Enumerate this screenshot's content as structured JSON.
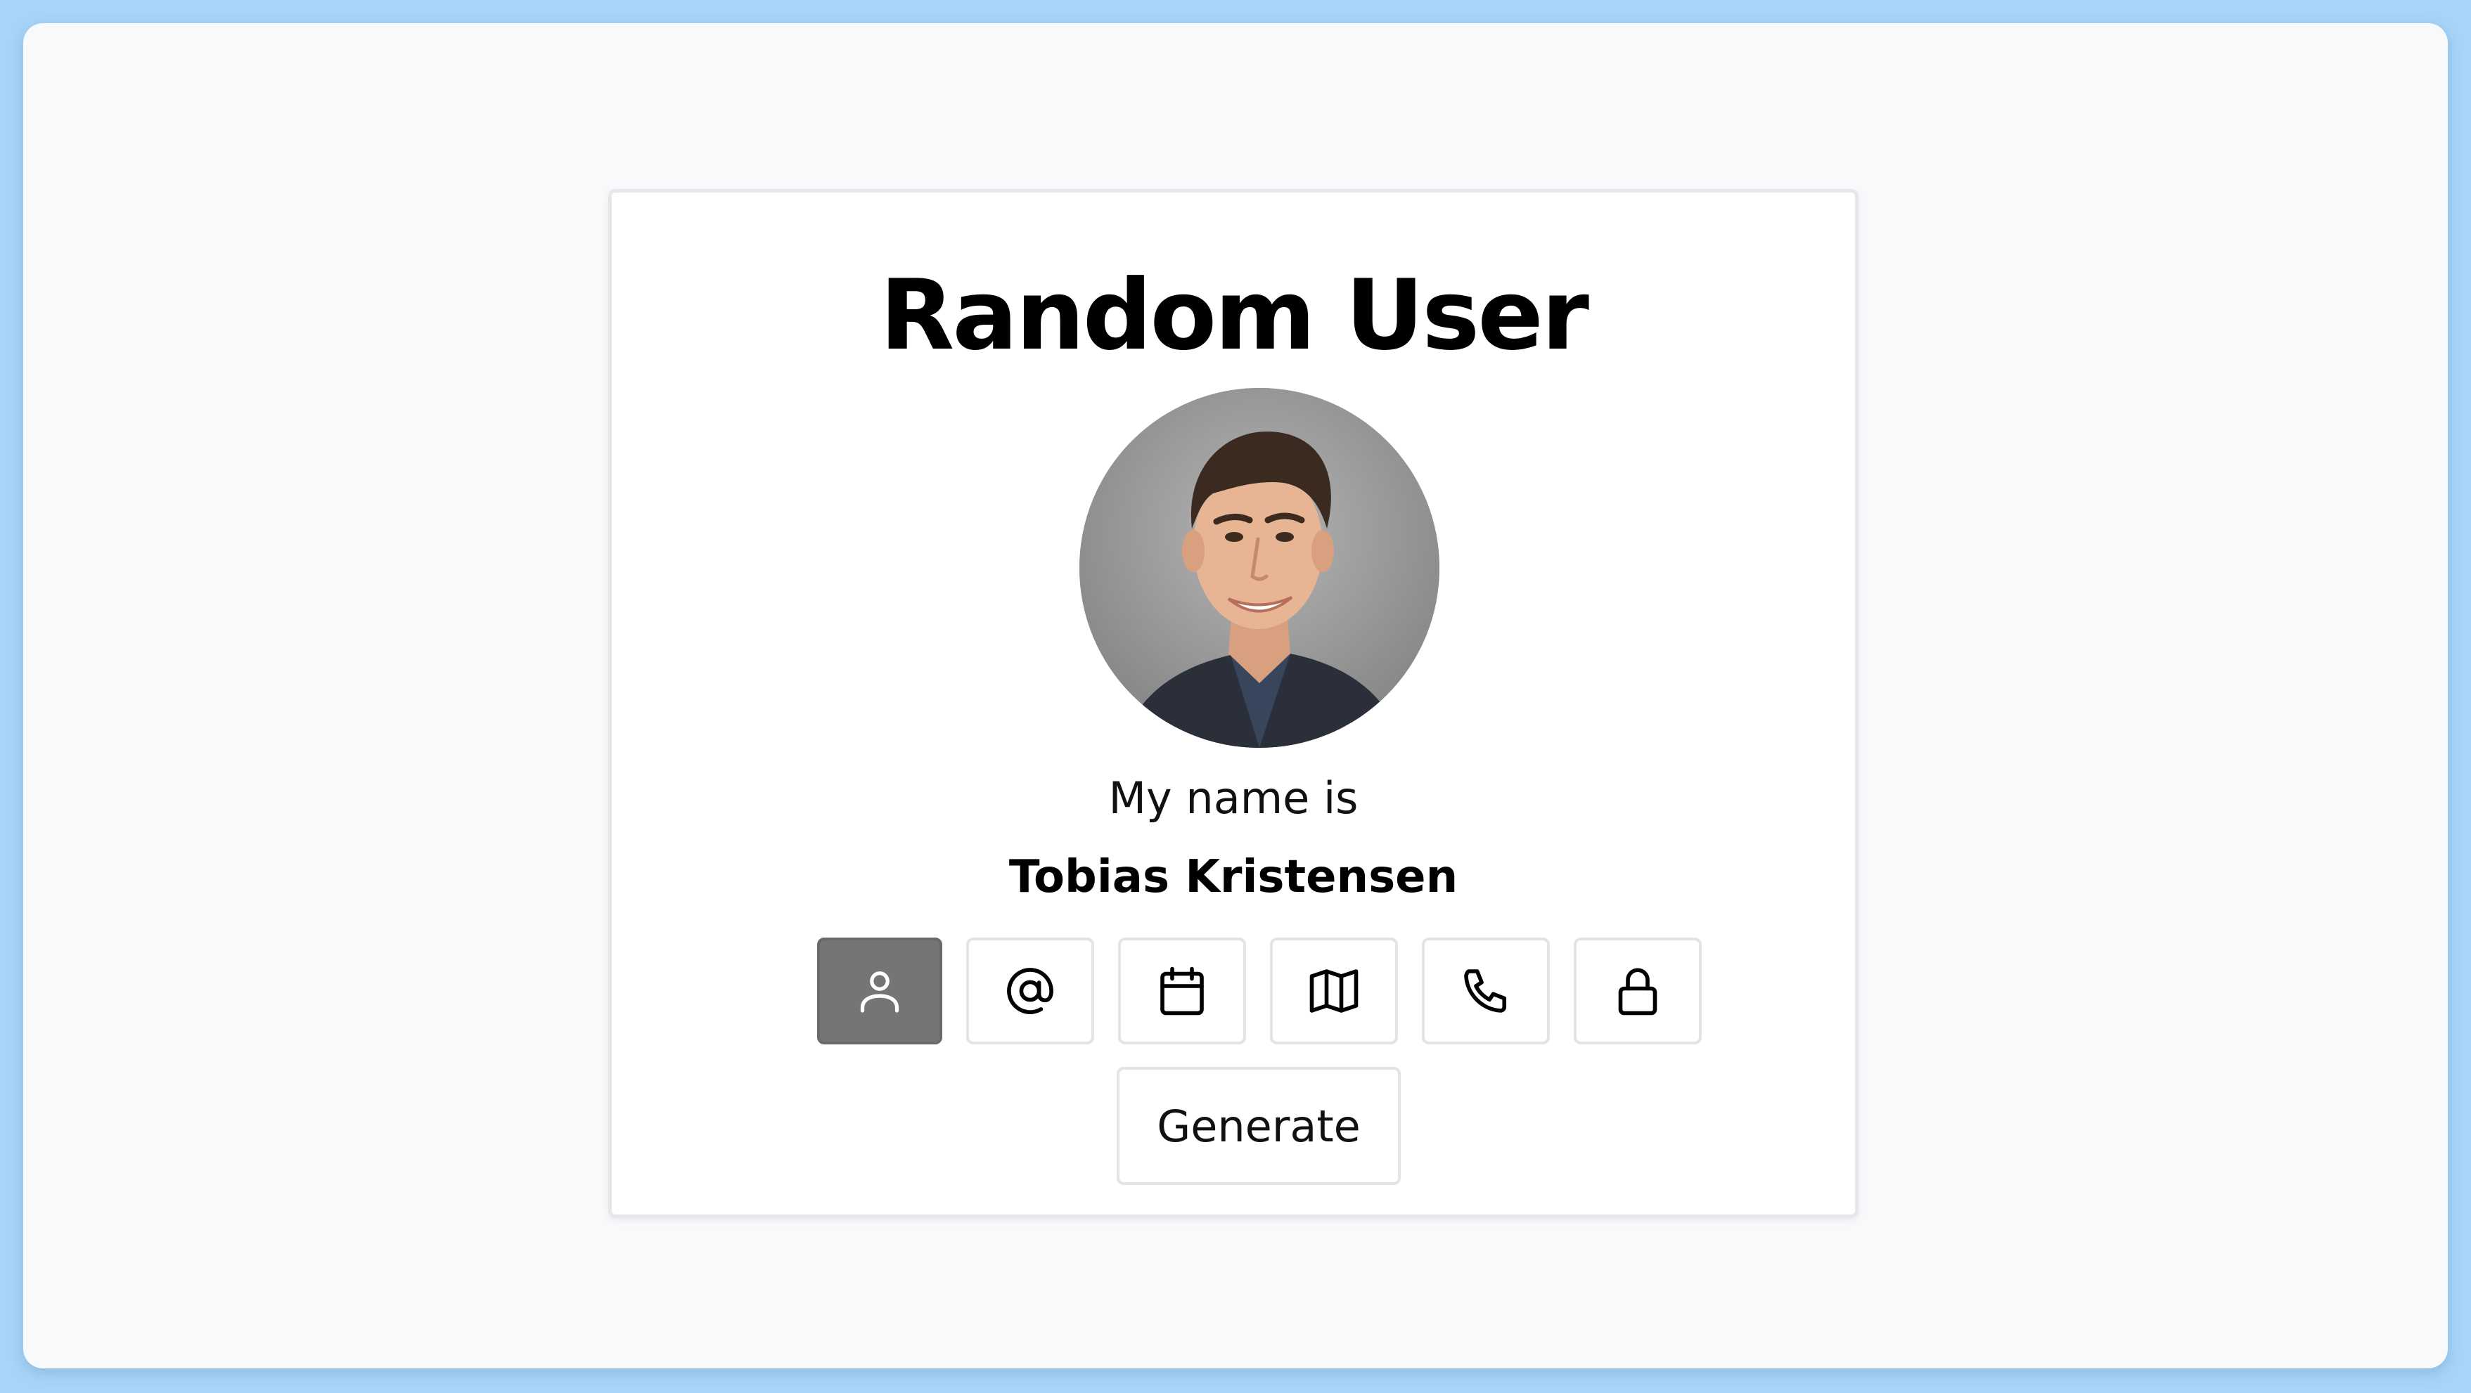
{
  "app": {
    "title": "Random User"
  },
  "profile": {
    "avatar_icon": "user-photo",
    "label": "My name is",
    "value": "Tobias Kristensen"
  },
  "info_buttons": [
    {
      "icon": "user-icon",
      "active": true
    },
    {
      "icon": "at-sign-icon",
      "active": false
    },
    {
      "icon": "calendar-icon",
      "active": false
    },
    {
      "icon": "map-icon",
      "active": false
    },
    {
      "icon": "phone-icon",
      "active": false
    },
    {
      "icon": "lock-icon",
      "active": false
    }
  ],
  "actions": {
    "generate_label": "Generate"
  },
  "colors": {
    "background": "#a7d4f7",
    "window": "#f8f9fb",
    "card": "#ffffff",
    "active_button": "#757575"
  }
}
